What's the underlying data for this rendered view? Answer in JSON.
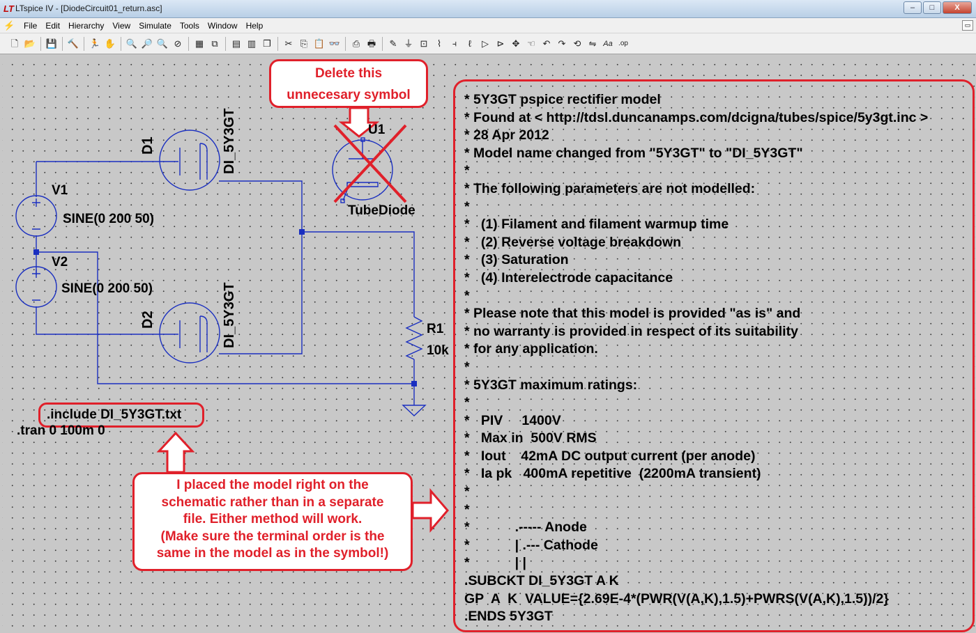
{
  "window": {
    "title": "LTspice IV - [DiodeCircuit01_return.asc]",
    "minimize_label": "–",
    "maximize_label": "□",
    "close_label": "X"
  },
  "menu": {
    "items": [
      "File",
      "Edit",
      "Hierarchy",
      "View",
      "Simulate",
      "Tools",
      "Window",
      "Help"
    ]
  },
  "toolbar": {
    "icons": [
      "new-schematic-icon",
      "open-icon",
      "save-icon",
      "control-panel-icon",
      "run-icon",
      "halt-icon",
      "zoom-in-icon",
      "zoom-area-icon",
      "zoom-out-icon",
      "zoom-fit-icon",
      "tile-icon",
      "cascade-icon",
      "window-icon",
      "cut-icon",
      "copy-icon",
      "paste-icon",
      "find-icon",
      "print-preview-icon",
      "print-icon",
      "draw-wire-icon",
      "ground-icon",
      "label-net-icon",
      "resistor-icon",
      "capacitor-icon",
      "inductor-icon",
      "diode-icon",
      "component-icon",
      "move-icon",
      "drag-icon",
      "undo-icon",
      "redo-icon",
      "rotate-icon",
      "mirror-icon",
      "text-icon",
      "spice-directive-icon"
    ]
  },
  "schematic": {
    "components": {
      "d1_ref": "D1",
      "d1_model": "DI_5Y3GT",
      "d2_ref": "D2",
      "d2_model": "DI_5Y3GT",
      "v1_ref": "V1",
      "v1_value": "SINE(0 200 50)",
      "v2_ref": "V2",
      "v2_value": "SINE(0 200 50)",
      "u1_ref": "U1",
      "u1_model": "TubeDiode",
      "r1_ref": "R1",
      "r1_value": "10k"
    },
    "directives": {
      "include": ".include DI_5Y3GT.txt",
      "tran": ".tran 0 100m 0"
    }
  },
  "annotations": {
    "delete_note": [
      "Delete this",
      "unnecesary symbol"
    ],
    "placed_note": [
      "I placed the model right on the",
      "schematic rather than in a separate",
      "file.  Either method will work.",
      "(Make sure the terminal order is the",
      "same in the model as in the symbol!)"
    ]
  },
  "spice_model": {
    "lines": [
      "* 5Y3GT pspice rectifier model",
      "* Found at < http://tdsl.duncanamps.com/dcigna/tubes/spice/5y3gt.inc >",
      "* 28 Apr 2012",
      "* Model name changed from \"5Y3GT\" to \"DI_5Y3GT\"",
      "*",
      "* The following parameters are not modelled:",
      "*",
      "*   (1) Filament and filament warmup time",
      "*   (2) Reverse voltage breakdown",
      "*   (3) Saturation",
      "*   (4) Interelectrode capacitance",
      "*",
      "* Please note that this model is provided \"as is\" and",
      "* no warranty is provided in respect of its suitability",
      "* for any application.",
      "*",
      "* 5Y3GT maximum ratings:",
      "*",
      "*   PIV     1400V",
      "*   Max in  500V RMS",
      "*   Iout    42mA DC output current (per anode)",
      "*   Ia pk   400mA repetitive  (2200mA transient)",
      "*",
      "*",
      "*            .----- Anode",
      "*            | .--- Cathode",
      "*            | |",
      ".SUBCKT DI_5Y3GT A K",
      "GP  A  K  VALUE={2.69E-4*(PWR(V(A,K),1.5)+PWRS(V(A,K),1.5))/2}",
      ".ENDS 5Y3GT"
    ]
  },
  "colors": {
    "wire": "#1a2fc0",
    "junction": "#1a2fc0",
    "annotation_red": "#e0202a",
    "canvas_bg": "#c8c8c8"
  }
}
